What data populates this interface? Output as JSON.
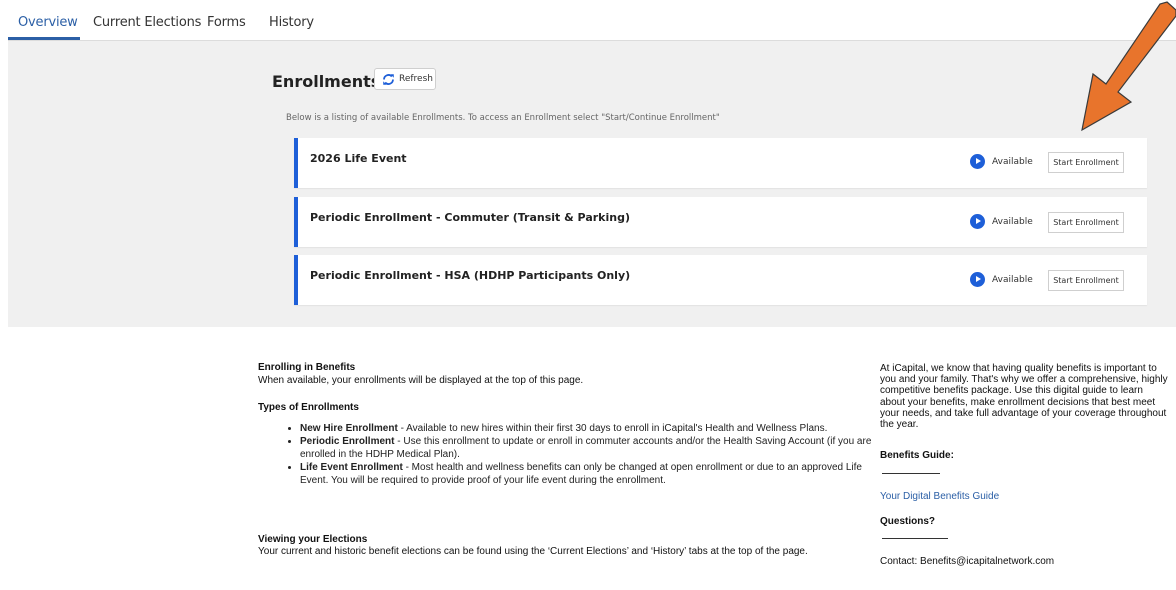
{
  "tabs": [
    {
      "label": "Overview"
    },
    {
      "label": "Current Elections"
    },
    {
      "label": "Forms"
    },
    {
      "label": "History"
    }
  ],
  "enrollments": {
    "title": "Enrollments",
    "refresh_label": "Refresh",
    "description": "Below is a listing of available Enrollments. To access an Enrollment select \"Start/Continue Enrollment\"",
    "items": [
      {
        "title": "2026 Life Event",
        "status": "Available",
        "action": "Start Enrollment"
      },
      {
        "title": "Periodic Enrollment - Commuter (Transit & Parking)",
        "status": "Available",
        "action": "Start Enrollment"
      },
      {
        "title": "Periodic Enrollment - HSA (HDHP Participants Only)",
        "status": "Available",
        "action": "Start Enrollment"
      }
    ]
  },
  "info": {
    "enrolling_head": "Enrolling in Benefits",
    "enrolling_text": "When available, your enrollments will be displayed at the top of this page.",
    "types_head": "Types of Enrollments",
    "types": [
      {
        "name": "New Hire Enrollment",
        "desc": " - Available to new hires within their first 30 days to enroll in iCapital's Health and Wellness Plans."
      },
      {
        "name": "Periodic Enrollment",
        "desc": " - Use this enrollment to update or enroll in commuter accounts and/or the Health Saving Account (if you are enrolled in the HDHP Medical Plan)."
      },
      {
        "name": "Life Event Enrollment",
        "desc": " - Most health and wellness benefits can only be changed at open enrollment or due to an approved Life Event. You will be required to provide proof of your life event during the enrollment."
      }
    ],
    "viewing_head": "Viewing your Elections",
    "viewing_text": "Your current and historic benefit elections can be found using the ‘Current Elections’ and ‘History’ tabs at the top of the page."
  },
  "sidebar": {
    "intro": "At iCapital, we know that having quality benefits is important to you and your family. That's why we offer a comprehensive, highly competitive benefits package. Use this digital guide to learn about your benefits, make enrollment decisions that best meet your needs, and take full advantage of your coverage throughout the year.",
    "guide_head": "Benefits Guide:",
    "guide_link": "Your Digital Benefits Guide",
    "questions_head": "Questions?",
    "contact": "Contact: Benefits@icapitalnetwork.com"
  },
  "colors": {
    "accent": "#1e5fd8",
    "arrow": "#e8742c",
    "panel_bg": "#f0f0f0"
  }
}
